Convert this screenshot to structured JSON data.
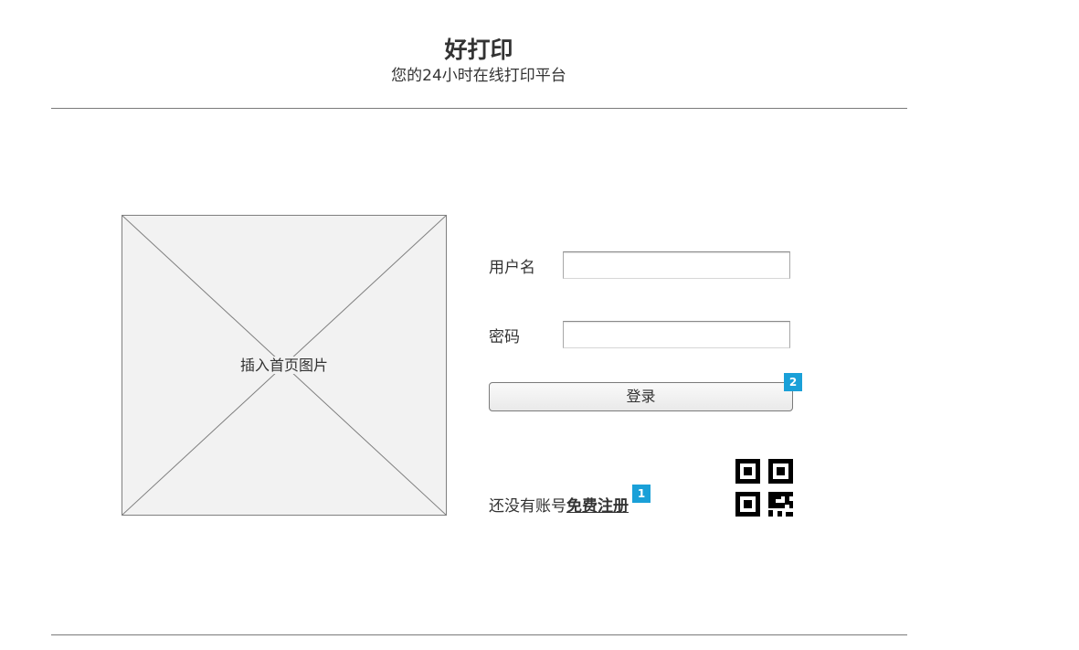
{
  "header": {
    "title": "好打印",
    "subtitle": "您的24小时在线打印平台"
  },
  "image_placeholder": {
    "label": "插入首页图片"
  },
  "login_form": {
    "username_label": "用户名",
    "username_value": "",
    "password_label": "密码",
    "password_value": "",
    "login_button_label": "登录",
    "login_badge": "2"
  },
  "register": {
    "prompt": "还没有账号",
    "link_label": "免费注册",
    "badge": "1"
  },
  "qr_code": {
    "icon": "qr-code-icon"
  },
  "colors": {
    "badge": "#1aa0d8",
    "placeholder_bg": "#f2f2f2",
    "divider": "#7a7a7a"
  }
}
